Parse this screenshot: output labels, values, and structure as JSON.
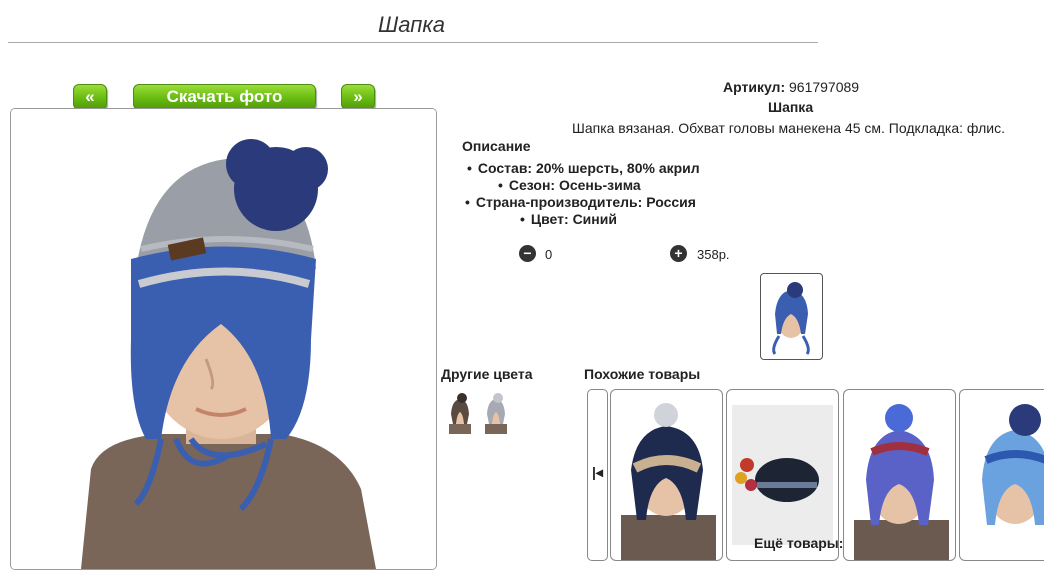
{
  "page": {
    "title": "Шапка"
  },
  "gallery": {
    "prev_label": "«",
    "download_label": "Скачать фото",
    "next_label": "»"
  },
  "product": {
    "article_label": "Артикул:",
    "article_value": "961797089",
    "name": "Шапка",
    "description": "Шапка вязаная. Обхват головы манекена 45 см. Подкладка: флис.",
    "description_heading": "Описание",
    "specs": [
      "Состав: 20% шерсть, 80% акрил",
      "Сезон: Осень-зима",
      "Страна-производитель: Россия",
      "Цвет: Синий"
    ],
    "quantity": "0",
    "price": "358р."
  },
  "sections": {
    "other_colors": "Другие цвета",
    "similar": "Похожие товары",
    "more": "Ещё товары:"
  },
  "colors": {
    "accent_green": "#6cbf14",
    "hat_blue": "#3a5fb0"
  }
}
